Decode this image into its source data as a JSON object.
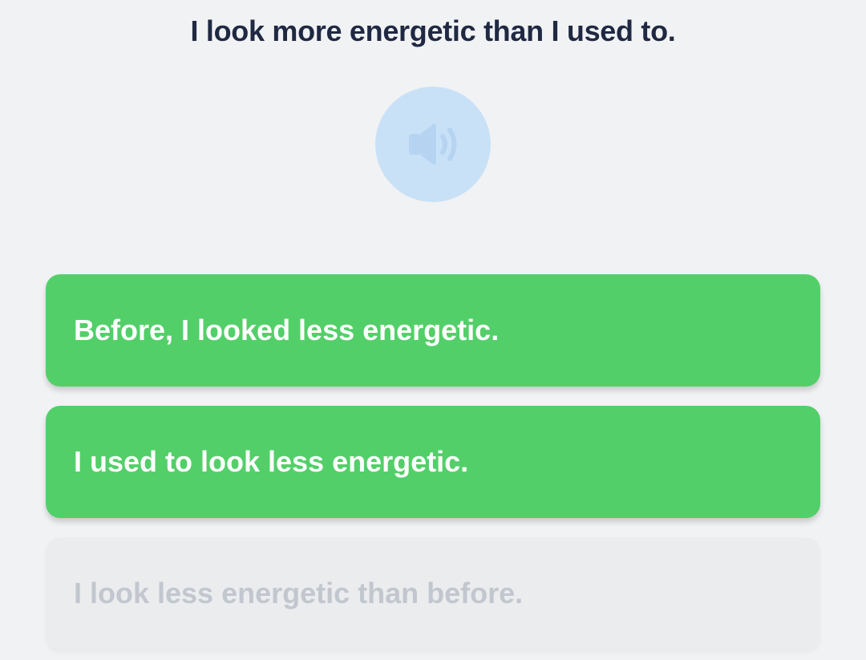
{
  "exercise": {
    "prompt": "I look more energetic than I used to.",
    "audio_icon": "speaker-icon",
    "colors": {
      "background": "#f1f2f4",
      "prompt_text": "#1f2942",
      "audio_bg": "#c9e1f7",
      "audio_icon": "#b6d4f1",
      "option_active": "#53cf69",
      "option_disabled": "#ebecee",
      "option_disabled_text": "#c2c6ce"
    },
    "options": [
      {
        "label": "Before, I looked less energetic.",
        "state": "active"
      },
      {
        "label": "I used to look less energetic.",
        "state": "active"
      },
      {
        "label": "I look less energetic than before.",
        "state": "disabled"
      }
    ]
  }
}
